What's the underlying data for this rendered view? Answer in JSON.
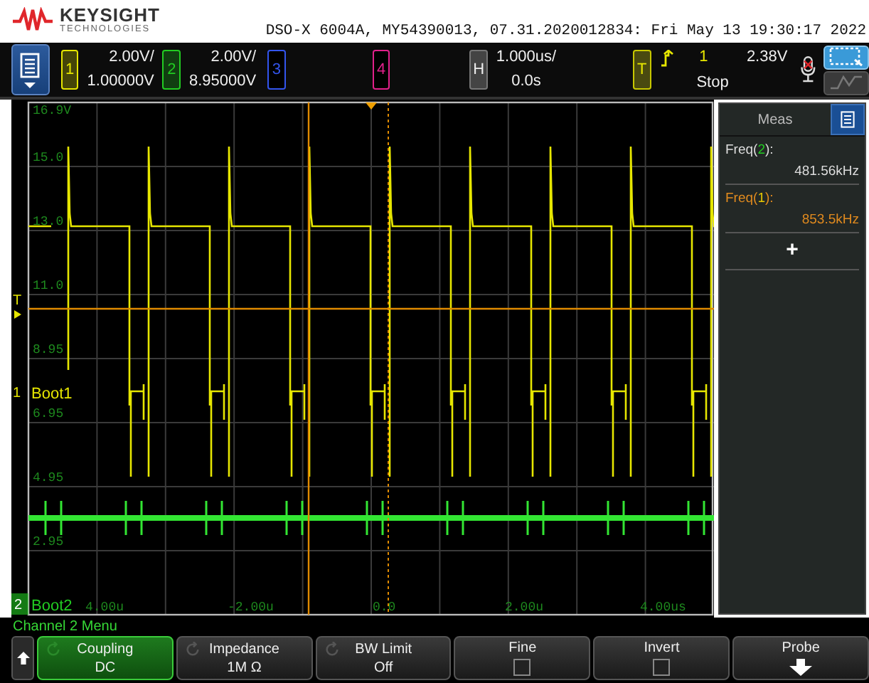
{
  "header": {
    "brand": "KEYSIGHT",
    "brand_sub": "TECHNOLOGIES",
    "instrument_info": "DSO-X 6004A, MY54390013, 07.31.2020012834: Fri May 13 19:30:17 2022"
  },
  "toolbar": {
    "channels": [
      {
        "number": "1",
        "on": true,
        "color": "#e6e600",
        "scale": "2.00V/",
        "offset": "1.00000V"
      },
      {
        "number": "2",
        "on": true,
        "color": "#22cc22",
        "scale": "2.00V/",
        "offset": "8.95000V"
      },
      {
        "number": "3",
        "on": false,
        "color": "#3355ee"
      },
      {
        "number": "4",
        "on": false,
        "color": "#e0208a"
      }
    ],
    "horizontal": {
      "key": "H",
      "scale": "1.000us/",
      "delay": "0.0s"
    },
    "trigger": {
      "key": "T",
      "source": "1",
      "level": "2.38V",
      "status": "Stop"
    }
  },
  "display": {
    "y_labels": [
      "16.9V",
      "15.0",
      "13.0",
      "11.0",
      "8.95",
      "6.95",
      "4.95",
      "2.95"
    ],
    "x_labels": [
      "4.00u",
      "-2.00u",
      "0.0",
      "2.00u",
      "4.00us"
    ],
    "markers": [
      {
        "kind": "trigger",
        "label": "T"
      },
      {
        "kind": "channel",
        "number": "1",
        "label": "Boot1"
      },
      {
        "kind": "channel",
        "number": "2",
        "label": "Boot2"
      }
    ]
  },
  "meas": {
    "title": "Meas",
    "items": [
      {
        "prefix": "Freq(",
        "channel": "2",
        "suffix": "):",
        "value": "481.56kHz",
        "color": "#22cc22",
        "selected": false
      },
      {
        "prefix": "Freq(",
        "channel": "1",
        "suffix": "):",
        "value": "853.5kHz",
        "color": "#e6c800",
        "selected": true
      }
    ],
    "add": "+"
  },
  "menu": {
    "title": "Channel 2 Menu",
    "keys": [
      {
        "kind": "value",
        "label": "Coupling",
        "value": "DC",
        "selected": true
      },
      {
        "kind": "value",
        "label": "Impedance",
        "value": "1M Ω",
        "selected": false
      },
      {
        "kind": "value",
        "label": "BW Limit",
        "value": "Off",
        "selected": false
      },
      {
        "kind": "checkbox",
        "label": "Fine",
        "checked": false,
        "selected": false
      },
      {
        "kind": "checkbox",
        "label": "Invert",
        "checked": false,
        "selected": false
      },
      {
        "kind": "submenu",
        "label": "Probe",
        "selected": false
      }
    ]
  }
}
